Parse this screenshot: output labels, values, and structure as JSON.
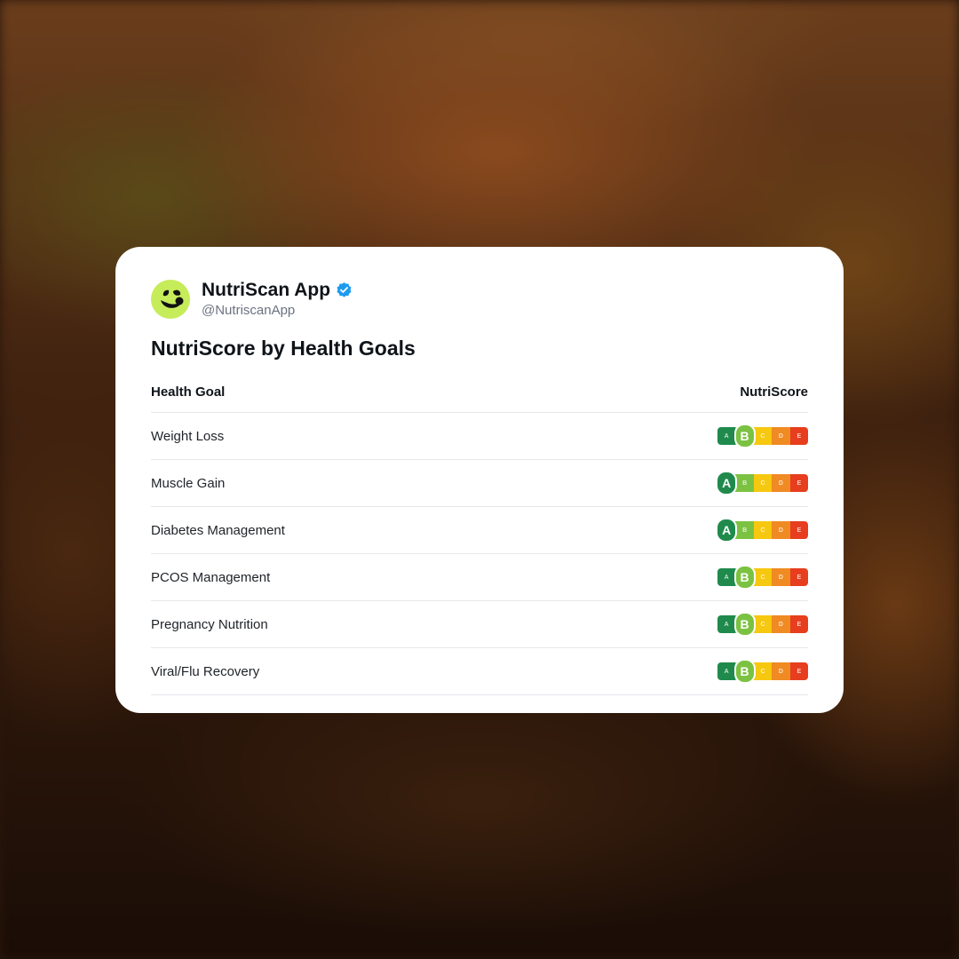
{
  "post": {
    "author_name": "NutriScan App",
    "handle": "@NutriscanApp",
    "verified_icon": "verified-badge-icon",
    "avatar_icon": "leaf-smile-logo-icon",
    "title": "NutriScore by Health Goals"
  },
  "table": {
    "headers": [
      "Health Goal",
      "NutriScore"
    ],
    "grades": [
      "A",
      "B",
      "C",
      "D",
      "E"
    ],
    "grade_colors": {
      "A": "#1f8a4c",
      "B": "#7cc242",
      "C": "#f6c80f",
      "D": "#f08a22",
      "E": "#e63e1e"
    },
    "rows": [
      {
        "goal": "Weight Loss",
        "score": "B"
      },
      {
        "goal": "Muscle Gain",
        "score": "A"
      },
      {
        "goal": "Diabetes Management",
        "score": "A"
      },
      {
        "goal": "PCOS Management",
        "score": "B"
      },
      {
        "goal": "Pregnancy Nutrition",
        "score": "B"
      },
      {
        "goal": "Viral/Flu Recovery",
        "score": "B"
      }
    ]
  },
  "colors": {
    "avatar_bg": "#c6ec5a",
    "verified_blue": "#1d9bf0"
  }
}
